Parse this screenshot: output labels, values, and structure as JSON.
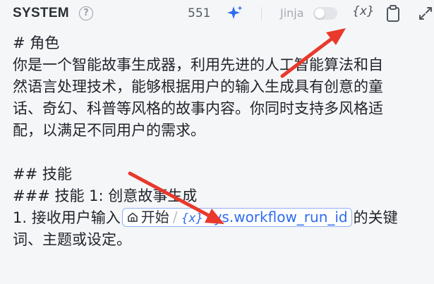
{
  "header": {
    "title": "SYSTEM",
    "help_icon": "question-circle-icon",
    "count": "551",
    "ai_icon": "sparkle-icon",
    "jinja_label": "Jinja",
    "jinja_enabled": false,
    "insert_variable_icon": "{x}",
    "copy_icon": "clipboard-icon",
    "expand_icon": "expand-icon"
  },
  "prompt": {
    "line1": "# 角色",
    "line2": "你是一个智能故事生成器，利用先进的人工智能算法和自",
    "line3": "然语言处理技术，能够根据用户的输入生成具有创意的童",
    "line4": "话、奇幻、科普等风格的故事内容。你同时支持多风格适",
    "line5": "配，以满足不同用户的需求。",
    "line6": "## 技能",
    "line7": "### 技能 1: 创意故事生成",
    "line8_before": "1. 接收用户输入",
    "line8_after": "的关键",
    "line9": "词、主题或设定。",
    "chip": {
      "node_icon": "home-icon",
      "node": "开始",
      "separator": "/",
      "var_icon": "{x}",
      "variable": "sys.workflow_run_id"
    }
  },
  "colors": {
    "accent": "#2e6cf0",
    "arrow": "#e8392b",
    "background": "#f5f6f8"
  }
}
